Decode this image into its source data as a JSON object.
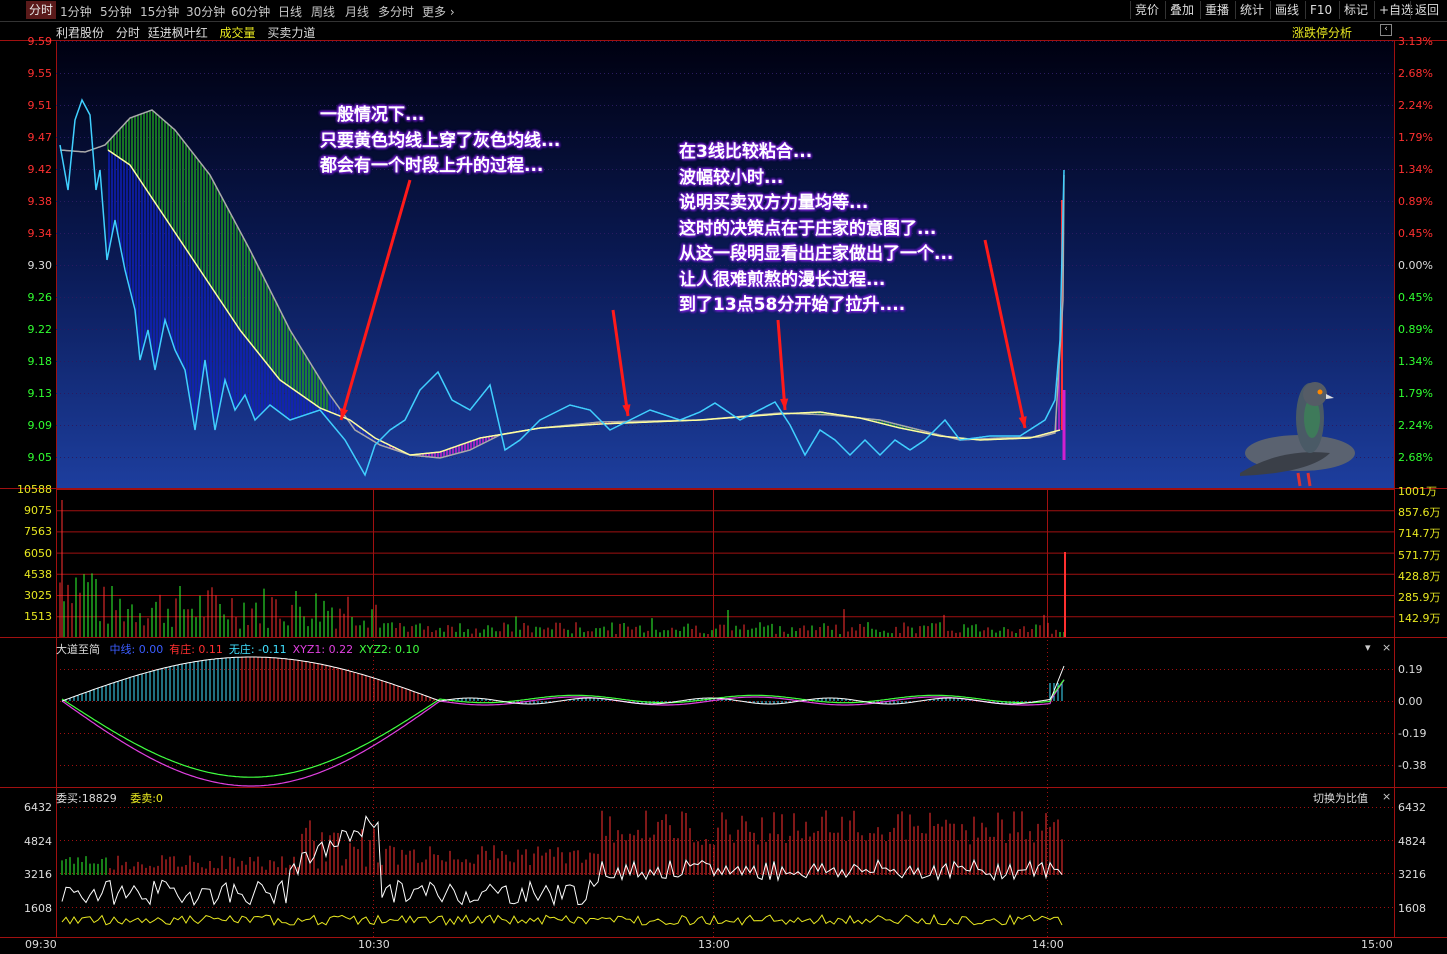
{
  "toolbar": {
    "tabs": [
      "分时",
      "1分钟",
      "5分钟",
      "15分钟",
      "30分钟",
      "60分钟",
      "日线",
      "周线",
      "月线",
      "多分时",
      "更多"
    ],
    "more_icon": "chevron-right-icon",
    "right_buttons": [
      "竞价",
      "叠加",
      "重播",
      "统计",
      "画线",
      "F10",
      "标记",
      "+自选",
      "返回"
    ]
  },
  "header": {
    "stock_name": "利君股份",
    "mode": "分时",
    "indicator": "廷进枫叶红",
    "volume_label": "成交量",
    "power_label": "买卖力道",
    "analysis_btn": "涨跌停分析"
  },
  "price_axis": {
    "left": [
      "9.59",
      "9.55",
      "9.51",
      "9.47",
      "9.42",
      "9.38",
      "9.34",
      "9.30",
      "9.26",
      "9.22",
      "9.18",
      "9.13",
      "9.09",
      "9.05"
    ],
    "right": [
      "3.13%",
      "2.68%",
      "2.24%",
      "1.79%",
      "1.34%",
      "0.89%",
      "0.45%",
      "0.00%",
      "0.45%",
      "0.89%",
      "1.34%",
      "1.79%",
      "2.24%",
      "2.68%"
    ]
  },
  "volume_axis": {
    "left": [
      "10588",
      "9075",
      "7563",
      "6050",
      "4538",
      "3025",
      "1513"
    ],
    "right": [
      "1001万",
      "857.6万",
      "714.7万",
      "571.7万",
      "428.8万",
      "285.9万",
      "142.9万"
    ]
  },
  "indicator_panel": {
    "title": "大道至简",
    "items": [
      {
        "k": "中线",
        "v": "0.00",
        "color": "#3b5cff"
      },
      {
        "k": "有庄",
        "v": "0.11",
        "color": "#ff3030"
      },
      {
        "k": "无庄",
        "v": "-0.11",
        "color": "#40e0ff"
      },
      {
        "k": "XYZ1",
        "v": "0.22",
        "color": "#e040e0"
      },
      {
        "k": "XYZ2",
        "v": "0.10",
        "color": "#40ff40"
      }
    ],
    "axis": [
      "0.19",
      "0.00",
      "-0.19",
      "-0.38"
    ]
  },
  "order_panel": {
    "buy": "委买:18829",
    "sell": "委卖:0",
    "switch_btn": "切换为比值",
    "axis": [
      "6432",
      "4824",
      "3216",
      "1608"
    ]
  },
  "time_axis": [
    "09:30",
    "10:30",
    "13:00",
    "14:00",
    "15:00"
  ],
  "annotations": {
    "a1": "一般情况下...\n只要黄色均线上穿了灰色均线...\n都会有一个时段上升的过程...",
    "a2": "在3线比较粘合...\n波幅较小时...\n说明买卖双方力量均等...\n这时的决策点在于庄家的意图了...\n从这一段明显看出庄家做出了一个...\n让人很难煎熬的漫长过程...\n到了13点58分开始了拉升...."
  },
  "colors": {
    "up": "#ff3030",
    "down": "#30ff30",
    "neutral": "#ffffff",
    "grid": "#a01010",
    "accent_purple": "#7a1fd6"
  }
}
